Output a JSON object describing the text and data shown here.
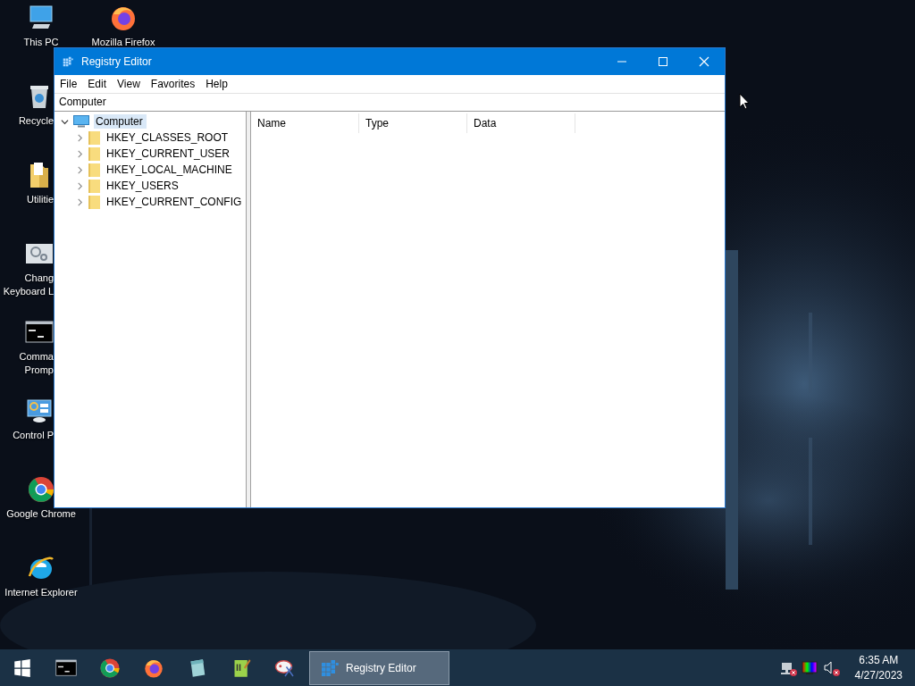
{
  "desktop": {
    "icons": [
      {
        "kind": "pc",
        "label_lines": [
          "This PC"
        ],
        "covered": false
      },
      {
        "kind": "recycle",
        "label_lines": [
          "Recycle"
        ],
        "covered": true
      },
      {
        "kind": "folder",
        "label_lines": [
          "Utilitie"
        ],
        "covered": true
      },
      {
        "kind": "gears",
        "label_lines": [
          "Chang",
          "Keyboard L"
        ],
        "covered": true
      },
      {
        "kind": "cmd",
        "label_lines": [
          "Comma",
          "Promp"
        ],
        "covered": true
      },
      {
        "kind": "control",
        "label_lines": [
          "Control P"
        ],
        "covered": true
      },
      {
        "kind": "chrome",
        "label_lines": [
          "Google Chrome"
        ],
        "covered": false
      },
      {
        "kind": "ie",
        "label_lines": [
          "Internet Explorer"
        ],
        "covered": false
      },
      {
        "kind": "firefox",
        "label_lines": [
          "Mozilla Firefox"
        ],
        "covered": false
      }
    ]
  },
  "window": {
    "title": "Registry Editor",
    "menu": [
      "File",
      "Edit",
      "View",
      "Favorites",
      "Help"
    ],
    "address": "Computer",
    "tree": {
      "label": "Computer",
      "expanded": true,
      "selected": true,
      "children": [
        {
          "label": "HKEY_CLASSES_ROOT",
          "expanded": false,
          "selected": false
        },
        {
          "label": "HKEY_CURRENT_USER",
          "expanded": false,
          "selected": false
        },
        {
          "label": "HKEY_LOCAL_MACHINE",
          "expanded": false,
          "selected": false
        },
        {
          "label": "HKEY_USERS",
          "expanded": false,
          "selected": false
        },
        {
          "label": "HKEY_CURRENT_CONFIG",
          "expanded": false,
          "selected": false
        }
      ]
    },
    "columns": [
      "Name",
      "Type",
      "Data"
    ]
  },
  "taskbar": {
    "items": [
      {
        "kind": "start",
        "selected": false
      },
      {
        "kind": "cmd",
        "selected": false
      },
      {
        "kind": "chrome",
        "selected": false
      },
      {
        "kind": "firefox",
        "selected": false
      },
      {
        "kind": "notepad",
        "selected": false
      },
      {
        "kind": "editor",
        "selected": false
      },
      {
        "kind": "paint",
        "selected": false
      },
      {
        "kind": "regedit",
        "label": "Registry Editor",
        "selected": true
      }
    ],
    "tray": [
      {
        "kind": "network",
        "error": true
      },
      {
        "kind": "display",
        "error": false
      },
      {
        "kind": "volume",
        "error": true
      }
    ],
    "clock": {
      "time": "6:35 AM",
      "date": "4/27/2023"
    }
  }
}
